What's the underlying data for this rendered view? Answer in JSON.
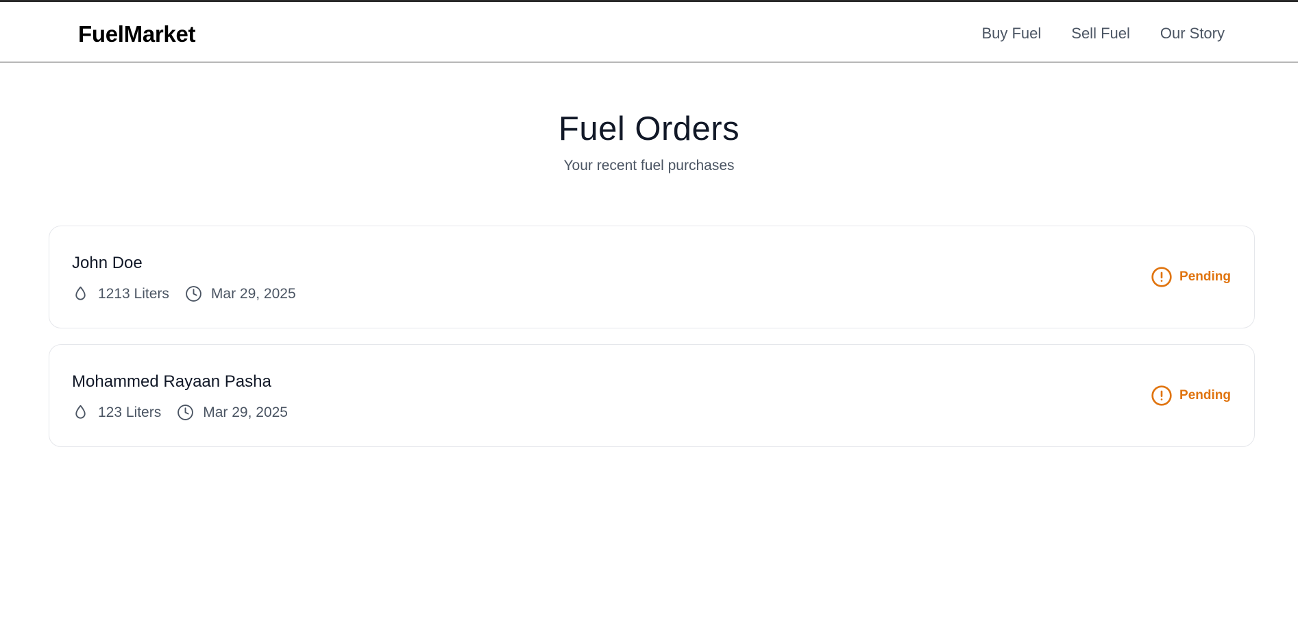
{
  "header": {
    "brand": "FuelMarket",
    "nav": [
      {
        "label": "Buy Fuel"
      },
      {
        "label": "Sell Fuel"
      },
      {
        "label": "Our Story"
      }
    ]
  },
  "main": {
    "title": "Fuel Orders",
    "subtitle": "Your recent fuel purchases"
  },
  "orders": [
    {
      "name": "John Doe",
      "quantity": "1213 Liters",
      "date": "Mar 29, 2025",
      "status": "Pending"
    },
    {
      "name": "Mohammed Rayaan Pasha",
      "quantity": "123 Liters",
      "date": "Mar 29, 2025",
      "status": "Pending"
    }
  ],
  "icons": {
    "quantity": "droplet-icon",
    "date": "clock-icon",
    "status": "alert-circle-icon"
  },
  "colors": {
    "status_pending": "#e0740f",
    "muted_text": "#4b5563",
    "card_border": "#e5e7eb"
  }
}
